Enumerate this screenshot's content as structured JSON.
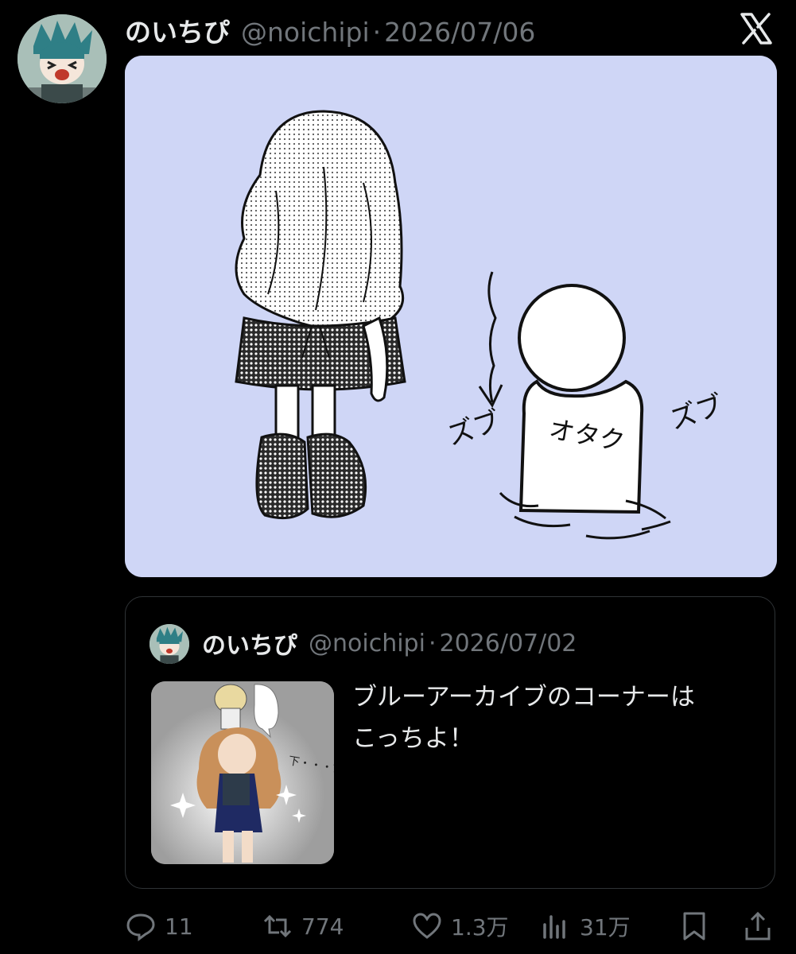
{
  "post": {
    "author_name": "のいちぴ",
    "handle": "@noichipi",
    "separator": "·",
    "date": "2026/07/06",
    "image": {
      "sfx_left": "ズブ",
      "sfx_right": "ズブ",
      "label_on_figure": "オタク",
      "background_color": "#cfd6f6"
    }
  },
  "quoted_post": {
    "author_name": "のいちぴ",
    "handle": "@noichipi",
    "separator": "·",
    "date": "2026/07/02",
    "text_line1": "ブルーアーカイブのコーナーは",
    "text_line2": "こっちよ！",
    "thumb": {
      "speech_bubble": "下・・・?"
    }
  },
  "actions": {
    "reply_count": "11",
    "repost_count": "774",
    "like_count": "1.3万",
    "views_count": "31万"
  },
  "icons": {
    "reply": "speech-bubble-icon",
    "repost": "repost-arrows-icon",
    "like": "heart-icon",
    "views": "bar-chart-icon",
    "bookmark": "bookmark-icon",
    "share": "share-icon",
    "brand": "x-logo-icon"
  }
}
